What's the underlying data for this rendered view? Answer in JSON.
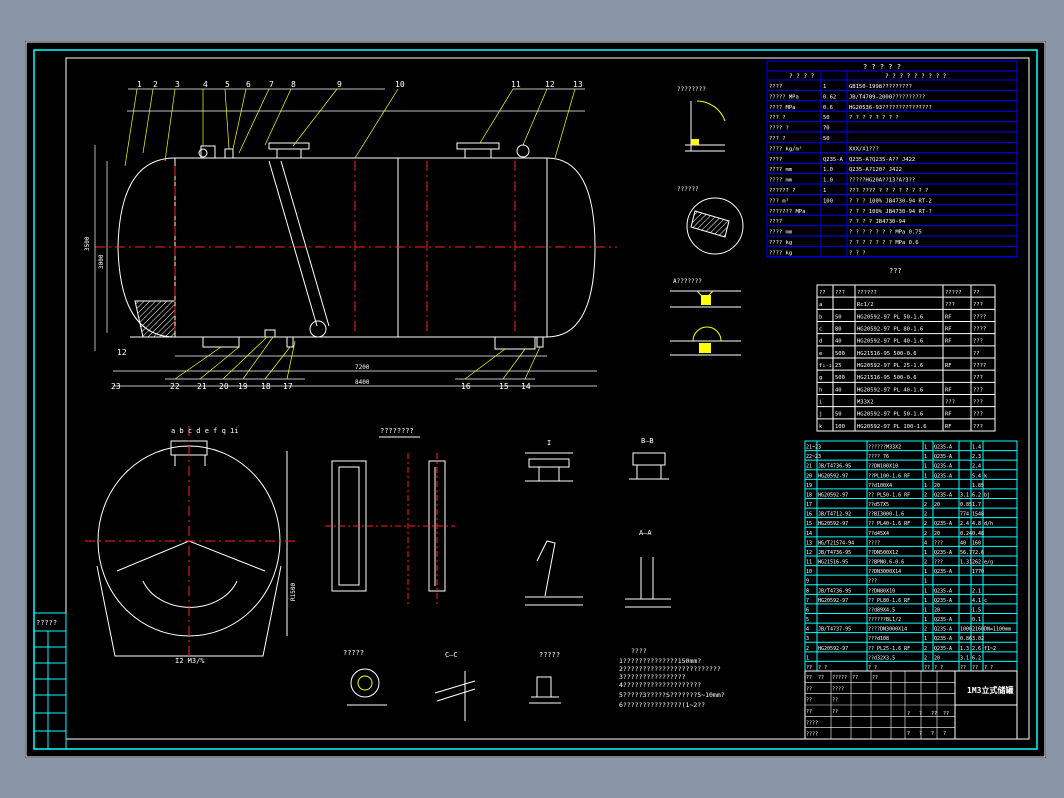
{
  "colors": {
    "background": "#8a96a8",
    "sheet": "#000000",
    "border": "#00ffff",
    "drawing": "#ffffff",
    "centerline": "#ff2020",
    "table": "#00ffff",
    "text": "#ffffff",
    "accent": "#ffff00",
    "leader": "#ffff00"
  },
  "balloons": {
    "top": [
      "1",
      "2",
      "3",
      "4",
      "5",
      "6",
      "7",
      "8",
      "9",
      "10",
      "11",
      "12",
      "13"
    ],
    "bottom": [
      "22",
      "21",
      "20",
      "19",
      "18",
      "17",
      "16",
      "15",
      "14"
    ],
    "left": [
      "12",
      "23"
    ]
  },
  "section_labels": {
    "a_a": "A—A",
    "b_b": "B—B",
    "c_c": "C—C",
    "title_box": "1M3立式储罐",
    "small_pipe_title": "???",
    "nozzle_table_title": "???",
    "notes_title": "????",
    "ladder_title": "????????",
    "detail_1": "?????",
    "detail_2": "????????",
    "detail_3": "??????",
    "detail_4": "?????",
    "weld_detail": "A???????",
    "detail_i": "I",
    "end_view_tags": "a b c d e f q   1i",
    "end_view_dim": "I2  M3/%"
  },
  "spec_table": {
    "header": "? ? ? ? ?",
    "sub_header_left": "? ? ? ?",
    "sub_header_right": "? ? ? ? ? ? ? ? ?",
    "rows": [
      [
        "????",
        "1",
        "GB150-1998?????????"
      ],
      [
        "?????  MPa",
        "0.62",
        "JB/T4709-2000??????????"
      ],
      [
        "????  MPa",
        "0.6",
        "HG20536-93???????????????"
      ],
      [
        "??? ?",
        "50",
        "? ? ? ? ? ? ? ?"
      ],
      [
        "???? ?",
        "70",
        ""
      ],
      [
        "??? ?",
        "50",
        ""
      ],
      [
        "???? kg/m³",
        "",
        "XXX/X1???"
      ],
      [
        "????",
        "Q235-A",
        "Q235-A?Q235-A??      J422"
      ],
      [
        "????  mm",
        "1.0",
        "Q235-A?120?          J422"
      ],
      [
        "????  mm",
        "1.0",
        "?????HG20A??13?A?3??"
      ],
      [
        "?????? ?",
        "1",
        "??? ???? ? ? ? ?  ?  ? ? ?"
      ],
      [
        "??? m³",
        "100",
        "? ? ?     100%   JB4730-94   RT-2"
      ],
      [
        "??????? MPa",
        "",
        "? ? ?     100%   JB4730-94   RT-?"
      ],
      [
        "????",
        "",
        "? ? ? ?            JB4730-94"
      ],
      [
        "???? mm",
        "",
        "? ? ? ? ? ? ?  MPa        0.75"
      ],
      [
        "???? kg",
        "",
        "? ? ? ? ? ? ?  MPa        0.6"
      ],
      [
        "???? kg",
        "",
        "? ? ?"
      ]
    ]
  },
  "nozzle_table": {
    "header": [
      "??",
      "???",
      "??????",
      "?????",
      "??"
    ],
    "rows": [
      [
        "a",
        "",
        "Rc1/2",
        "???",
        "???"
      ],
      [
        "b",
        "50",
        "HG20592-97 PL 50-1.6",
        "RF",
        "????"
      ],
      [
        "c",
        "80",
        "HG20592-97 PL 80-1.6",
        "RF",
        "????"
      ],
      [
        "d",
        "40",
        "HG20592-97 PL 40-1.6",
        "RF",
        "???"
      ],
      [
        "e",
        "500",
        "HG21516-95  500-0.6",
        "",
        "??"
      ],
      [
        "f₁₋₂",
        "25",
        "HG20592-97 PL 25-1.6",
        "RF",
        "????"
      ],
      [
        "g",
        "500",
        "HG21516-95  500-0.6",
        "",
        "???"
      ],
      [
        "h",
        "40",
        "HG20592-97 PL 40-1.6",
        "RF",
        "???"
      ],
      [
        "i",
        "",
        "M33X2",
        "???",
        "???"
      ],
      [
        "j",
        "50",
        "HG20592-97 PL 50-1.6",
        "RF",
        "???"
      ],
      [
        "k",
        "100",
        "HG20592-97 PL 100-1.6",
        "RF",
        "???"
      ]
    ]
  },
  "parts_table": {
    "header": [
      "??",
      "? ?",
      "? ?",
      "??",
      "? ?",
      "??",
      "??",
      "? ?"
    ],
    "rows": [
      [
        "21~23",
        "",
        "??????M33X2",
        "1",
        "Q235-A",
        "",
        "1.4",
        ""
      ],
      [
        "22~23",
        "",
        "???? 76",
        "1",
        "Q235-A",
        "",
        "2.3",
        ""
      ],
      [
        "21",
        "JB/T4736-95",
        "??DN100X10",
        "1",
        "Q235-A",
        "",
        "2.4",
        ""
      ],
      [
        "20",
        "HG20592-97",
        "??PL100-1.6 RF",
        "1",
        "Q235-A",
        "",
        "5.4",
        "k"
      ],
      [
        "19",
        "",
        "??d100X4",
        "1",
        "20",
        "",
        "1.85",
        ""
      ],
      [
        "18",
        "HG20592-97",
        "?? PL50-1.6 RF",
        "2",
        "Q235-A",
        "3.1",
        "6.2",
        "bj"
      ],
      [
        "17",
        "",
        "??d57X5",
        "2",
        "20",
        "0.85",
        "1.7",
        ""
      ],
      [
        "16",
        "JB/T4712-92",
        "??BI3000-1.6",
        "2",
        "",
        "774",
        "1548",
        ""
      ],
      [
        "15",
        "HG20592-97",
        "?? PL40-1.6 RF",
        "2",
        "Q235-A",
        "2.4",
        "4.8",
        "d/h"
      ],
      [
        "14",
        "",
        "??d45X4",
        "2",
        "20",
        "0.24",
        "0.48",
        ""
      ],
      [
        "13",
        "HG/T21574-94",
        "????",
        "4",
        "???",
        "40",
        "160",
        ""
      ],
      [
        "12",
        "JB/T4736-95",
        "??DN500X12",
        "1",
        "Q235-A",
        "56.7",
        "72.6",
        ""
      ],
      [
        "11",
        "HG21516-95",
        "??BPN0.6-0.6",
        "2",
        "???",
        "1.31",
        "262",
        "e/g"
      ],
      [
        "10",
        "",
        "??DN3000X14",
        "1",
        "Q235-A",
        "",
        "1770",
        ""
      ],
      [
        "9",
        "",
        "???",
        "1",
        "",
        "",
        "",
        ""
      ],
      [
        "8",
        "JB/T4736-95",
        "??DN80X10",
        "1",
        "Q235-A",
        "",
        "2.1",
        ""
      ],
      [
        "7",
        "HG20592-97",
        "?? PL80-1.6 RF",
        "1",
        "Q235-A",
        "",
        "4.1",
        "c"
      ],
      [
        "6",
        "",
        "??d89X4.5",
        "1",
        "20",
        "",
        "1.5",
        ""
      ],
      [
        "5",
        "",
        "??????BL1/2",
        "1",
        "Q235-A",
        "",
        "0.1",
        ""
      ],
      [
        "4",
        "JB/T4737-95",
        "????DN3000X14",
        "2",
        "Q235-A",
        "1000",
        "2160",
        "DN=1100mm"
      ],
      [
        "3",
        "",
        "???d108",
        "1",
        "Q235-A",
        "0.86",
        "3.02",
        ""
      ],
      [
        "2",
        "HG20592-97",
        "?? PL25-1.6 RF",
        "2",
        "Q235-A",
        "1.3",
        "2.6",
        "f1~2"
      ],
      [
        "1",
        "",
        "??d32X3.5",
        "2",
        "20",
        "3.1",
        "6.2",
        ""
      ]
    ]
  },
  "title_block": {
    "product": "1M3立式储罐",
    "rows": [
      [
        "??",
        "??",
        "?????",
        "??",
        "??"
      ],
      [
        "??",
        "",
        "????",
        "",
        ""
      ],
      [
        "??",
        "",
        "??",
        "",
        ""
      ],
      [
        "??",
        "",
        "??",
        "",
        ""
      ],
      [
        "????",
        "",
        "",
        "",
        ""
      ],
      [
        "????",
        "",
        "",
        "",
        ""
      ]
    ],
    "sub": [
      "?",
      "?",
      "??",
      "??"
    ],
    "sub2": [
      "?",
      "?",
      "?",
      "?"
    ]
  },
  "revision_block": [
    "?????",
    "",
    "",
    "",
    "",
    "",
    ""
  ],
  "notes": [
    "1??????????????150mm?",
    "2?????????????????????????",
    "3????????????????",
    "4????????????????????",
    "5?????3?????S???????5~10mm?",
    "6???????????????(1~2??"
  ],
  "dimensions": {
    "overall_length": "8400",
    "shell_length": "7200",
    "diameter": "3000",
    "left_vertical": "3500",
    "left_vertical_2": "3000",
    "end_view_radius": "R1500"
  }
}
